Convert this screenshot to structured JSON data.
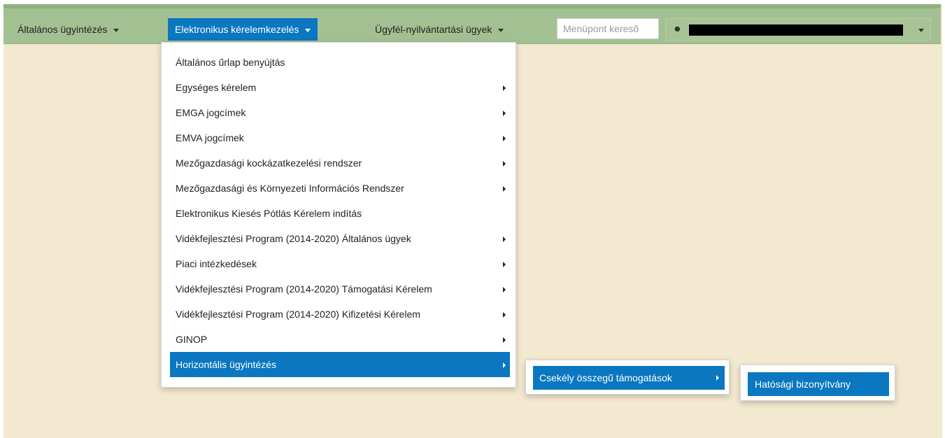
{
  "navbar": {
    "items": [
      {
        "label": "Általános ügyintézés"
      },
      {
        "label": "Elektronikus kérelemkezelés"
      },
      {
        "label": "Ügyfél-nyilvántartási ügyek"
      }
    ],
    "search_placeholder": "Menüpont kereső",
    "user_icon": "user-icon"
  },
  "colors": {
    "navbar_bg": "#a3c092",
    "page_bg": "#f3e9d1",
    "accent": "#0a77c0"
  },
  "menu": {
    "items": [
      {
        "label": "Általános űrlap benyújtás"
      },
      {
        "label": "Egységes kérelem"
      },
      {
        "label": "EMGA jogcímek"
      },
      {
        "label": "EMVA jogcímek"
      },
      {
        "label": "Mezőgazdasági kockázatkezelési rendszer"
      },
      {
        "label": "Mezőgazdasági és Környezeti Információs Rendszer"
      },
      {
        "label": "Elektronikus Kiesés Pótlás Kérelem indítás"
      },
      {
        "label": "Vidékfejlesztési Program (2014-2020) Általános ügyek"
      },
      {
        "label": "Piaci intézkedések"
      },
      {
        "label": "Vidékfejlesztési Program (2014-2020) Támogatási Kérelem"
      },
      {
        "label": "Vidékfejlesztési Program (2014-2020) Kifizetési Kérelem"
      },
      {
        "label": "GINOP"
      },
      {
        "label": "Horizontális ügyintézés"
      }
    ],
    "submenu": {
      "label": "Csekély összegű támogatások"
    },
    "subsubmenu": {
      "label": "Hatósági bizonyítvány"
    }
  }
}
